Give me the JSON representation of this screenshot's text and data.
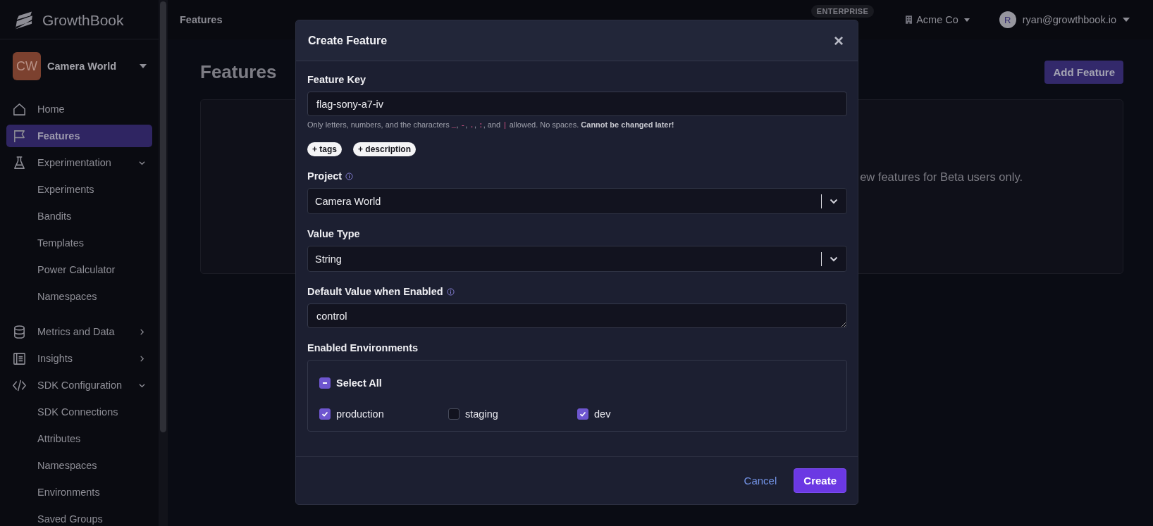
{
  "sidebar": {
    "logo": "GrowthBook",
    "project": {
      "initials": "CW",
      "name": "Camera World"
    },
    "items": [
      {
        "label": "Home",
        "selected": false
      },
      {
        "label": "Features",
        "selected": true
      },
      {
        "label": "Experimentation",
        "selected": false,
        "expanded": true,
        "children": [
          {
            "label": "Experiments",
            "selected": false
          },
          {
            "label": "Bandits",
            "selected": false
          },
          {
            "label": "Templates",
            "selected": false
          },
          {
            "label": "Power Calculator",
            "selected": false
          },
          {
            "label": "Namespaces",
            "selected": false
          }
        ]
      },
      {
        "label": "Metrics and Data",
        "selected": false,
        "expanded": false
      },
      {
        "label": "Insights",
        "selected": false,
        "expanded": false
      },
      {
        "label": "SDK Configuration",
        "selected": false,
        "expanded": true,
        "children": [
          {
            "label": "SDK Connections",
            "selected": false
          },
          {
            "label": "Attributes",
            "selected": false
          },
          {
            "label": "Namespaces",
            "selected": false
          },
          {
            "label": "Environments",
            "selected": false
          },
          {
            "label": "Saved Groups",
            "selected": false
          }
        ]
      }
    ]
  },
  "topbar": {
    "breadcrumb": "Features",
    "plan_badge": "ENTERPRISE",
    "org": "Acme Co",
    "user": {
      "initial": "R",
      "email": "ryan@growthbook.io"
    }
  },
  "page": {
    "title": "Features",
    "add_button": "Add Feature",
    "empty_text": "ew features for Beta users only."
  },
  "modal": {
    "title": "Create Feature",
    "close": "×",
    "fields": [
      {
        "kind": "input",
        "label": "Feature Key",
        "value": "flag-sony-a7-iv",
        "help": [
          {
            "kind": "text",
            "text": "Only letters, numbers, and the characters "
          },
          {
            "kind": "code",
            "text": "_"
          },
          {
            "kind": "text",
            "text": ", "
          },
          {
            "kind": "code",
            "text": "-"
          },
          {
            "kind": "text",
            "text": ", "
          },
          {
            "kind": "code",
            "text": "."
          },
          {
            "kind": "text",
            "text": ", "
          },
          {
            "kind": "code",
            "text": ":"
          },
          {
            "kind": "text",
            "text": ", and "
          },
          {
            "kind": "code",
            "text": "|"
          },
          {
            "kind": "text",
            "text": " allowed. No spaces. "
          },
          {
            "kind": "strong",
            "text": "Cannot be changed later!"
          }
        ]
      },
      {
        "kind": "pills",
        "pills": [
          "+ tags",
          "+ description"
        ]
      },
      {
        "kind": "select",
        "label": "Project",
        "info": true,
        "value": "Camera World"
      },
      {
        "kind": "select",
        "label": "Value Type",
        "info": false,
        "value": "String"
      },
      {
        "kind": "textarea",
        "label": "Default Value when Enabled",
        "info": true,
        "value": "control"
      },
      {
        "kind": "environments",
        "label": "Enabled Environments",
        "select_all": {
          "label": "Select All",
          "indeterminate": true
        },
        "options": [
          {
            "label": "production",
            "checked": true
          },
          {
            "label": "staging",
            "checked": false
          },
          {
            "label": "dev",
            "checked": true
          }
        ]
      }
    ],
    "buttons": [
      {
        "label": "Cancel",
        "kind": "link"
      },
      {
        "label": "Create",
        "kind": "primary"
      }
    ]
  }
}
